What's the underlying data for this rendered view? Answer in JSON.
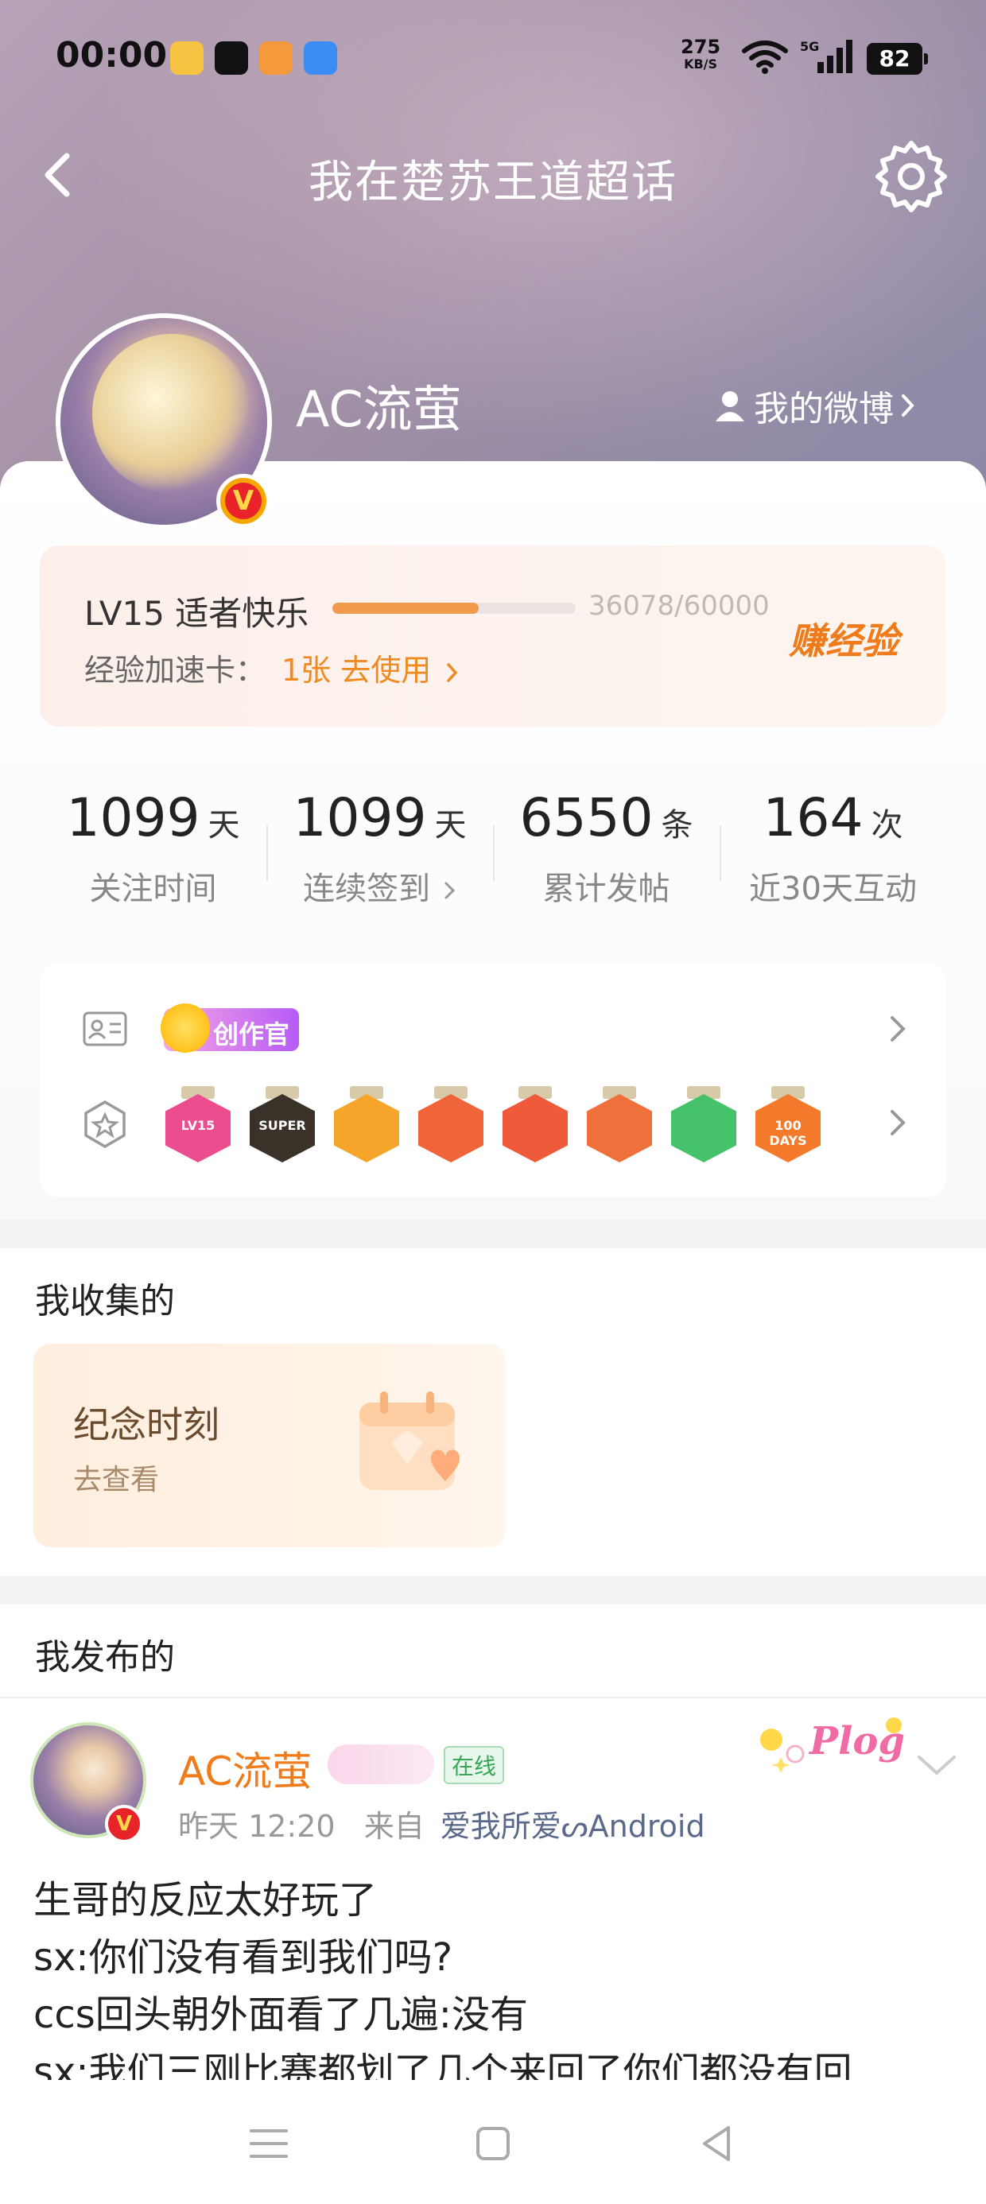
{
  "status_bar": {
    "time": "00:00",
    "net_speed_value": "275",
    "net_speed_unit": "KB/S",
    "network_type": "5G",
    "battery": "82"
  },
  "header": {
    "title": "我在楚苏王道超话"
  },
  "profile": {
    "username": "AC流萤",
    "my_weibo_label": "我的微博",
    "verified_mark": "V"
  },
  "level": {
    "label": "LV15 适者快乐",
    "progress": 0.6013,
    "exp_text": "36078/60000",
    "earn_label": "赚经验",
    "accel_label": "经验加速卡：",
    "accel_action": "1张 去使用"
  },
  "stats": [
    {
      "value": "1099",
      "unit": "天",
      "label": "关注时间",
      "has_chevron": false
    },
    {
      "value": "1099",
      "unit": "天",
      "label": "连续签到",
      "has_chevron": true
    },
    {
      "value": "6550",
      "unit": "条",
      "label": "累计发帖",
      "has_chevron": false
    },
    {
      "value": "164",
      "unit": "次",
      "label": "近30天互动",
      "has_chevron": false
    }
  ],
  "badges": {
    "creator_label": "创作官",
    "medals": [
      {
        "name": "lv15-medal",
        "text": "LV15",
        "color": "#ec4d8f"
      },
      {
        "name": "super-medal",
        "text": "SUPER",
        "color": "#3a3128"
      },
      {
        "name": "crown-medal",
        "text": "",
        "color": "#f5a62a"
      },
      {
        "name": "cat-medal-1",
        "text": "",
        "color": "#f0643a"
      },
      {
        "name": "cat-medal-2",
        "text": "",
        "color": "#ef5a3a"
      },
      {
        "name": "cat-medal-3",
        "text": "",
        "color": "#f0703c"
      },
      {
        "name": "hand-medal",
        "text": "",
        "color": "#45c26a"
      },
      {
        "name": "100-days-medal",
        "text": "100 DAYS",
        "color": "#f37a2a"
      }
    ]
  },
  "collection": {
    "section_title": "我收集的",
    "card_title": "纪念时刻",
    "card_sub": "去查看"
  },
  "posts": {
    "section_title": "我发布的",
    "items": [
      {
        "author": "AC流萤",
        "online_label": "在线",
        "sticker_text": "Plog",
        "time": "昨天 12:20",
        "source_prefix": "来自",
        "source": "爱我所爱ᔕAndroid",
        "lines": [
          "生哥的反应太好玩了",
          "sx:你们没有看到我们吗?",
          "ccs回头朝外面看了几遍:没有",
          "sx:我们三刚比赛都划了几个来回了你们都没有回"
        ]
      }
    ]
  },
  "colors": {
    "accent_orange": "#f07b1b",
    "progress_fill": "#f29a4c",
    "hero_bg": "#a793a8"
  }
}
